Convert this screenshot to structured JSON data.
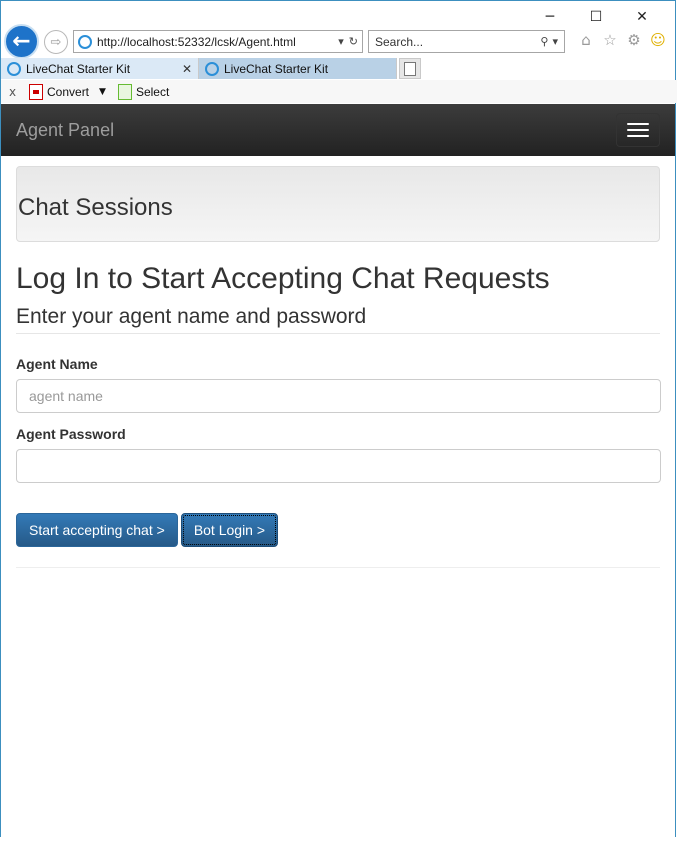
{
  "browser": {
    "window_controls": {
      "minimize": "─",
      "maximize": "☐",
      "close": "✕"
    },
    "address": "http://localhost:52332/lcsk/Agent.html",
    "search_placeholder": "Search...",
    "tabs": [
      {
        "label": "LiveChat Starter Kit",
        "active": true
      },
      {
        "label": "LiveChat Starter Kit",
        "active": false
      }
    ],
    "command_bar": {
      "close": "x",
      "convert_label": "Convert",
      "select_label": "Select"
    },
    "icons": [
      "back-arrow-icon",
      "forward-arrow-icon",
      "ie-icon",
      "refresh-icon",
      "search-icon",
      "home-icon",
      "star-icon",
      "gear-icon",
      "smiley-icon"
    ]
  },
  "page": {
    "navbar": {
      "brand": "Agent Panel"
    },
    "jumbotron": {
      "title": "Chat Sessions"
    },
    "title": "Log In to Start Accepting Chat Requests",
    "subtitle": "Enter your agent name and password",
    "form": {
      "agent_name_label": "Agent Name",
      "agent_name_placeholder": "agent name",
      "agent_name_value": "",
      "agent_password_label": "Agent Password",
      "agent_password_value": ""
    },
    "buttons": {
      "start": "Start accepting chat >",
      "bot": "Bot Login >"
    },
    "colors": {
      "navbar_bg": "#222222",
      "primary_button": "#337ab7",
      "tab_active": "#dbe9f6",
      "tab_inactive": "#b9d1e6"
    }
  }
}
